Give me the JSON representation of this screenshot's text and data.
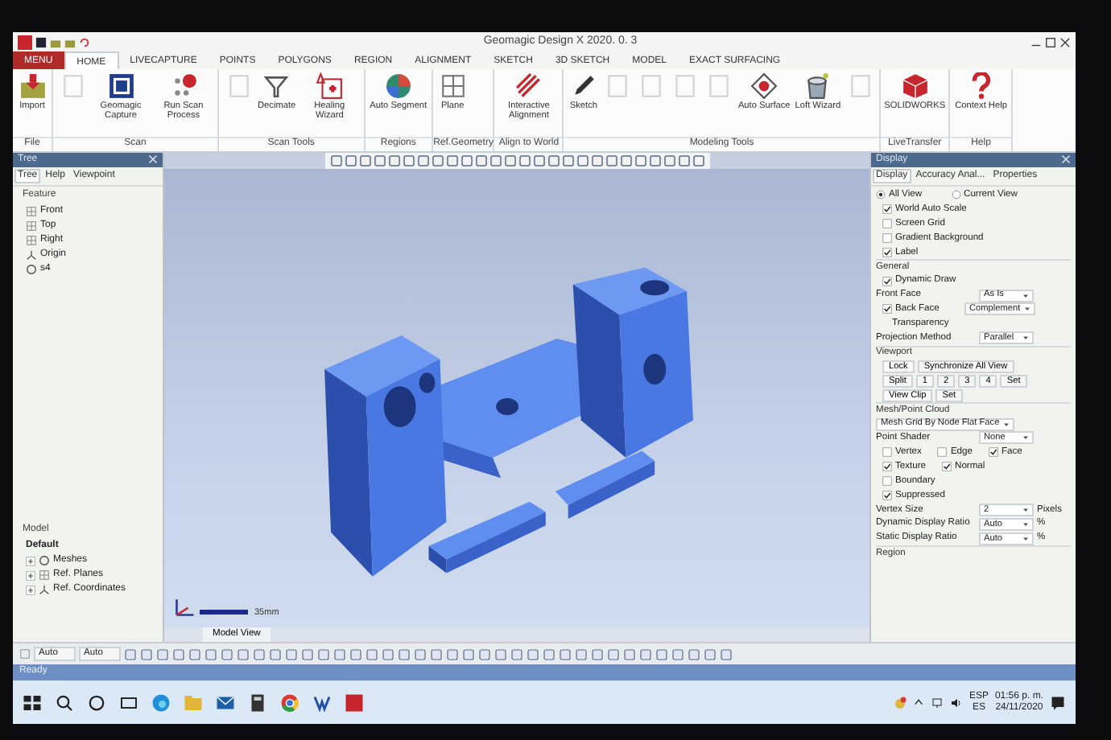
{
  "window": {
    "title": "Geomagic Design X 2020. 0. 3"
  },
  "ribbon_tabs": [
    {
      "label": "MENU",
      "kind": "menu",
      "selected": false
    },
    {
      "label": "HOME",
      "kind": "tab",
      "selected": true
    },
    {
      "label": "LIVECAPTURE",
      "kind": "tab",
      "selected": false
    },
    {
      "label": "POINTS",
      "kind": "tab",
      "selected": false
    },
    {
      "label": "POLYGONS",
      "kind": "tab",
      "selected": false
    },
    {
      "label": "REGION",
      "kind": "tab",
      "selected": false
    },
    {
      "label": "ALIGNMENT",
      "kind": "tab",
      "selected": false
    },
    {
      "label": "SKETCH",
      "kind": "tab",
      "selected": false
    },
    {
      "label": "3D SKETCH",
      "kind": "tab",
      "selected": false
    },
    {
      "label": "MODEL",
      "kind": "tab",
      "selected": false
    },
    {
      "label": "EXACT SURFACING",
      "kind": "tab",
      "selected": false
    }
  ],
  "ribbon_groups": [
    {
      "label": "File",
      "buttons": [
        {
          "label": "Import",
          "disabled": false
        }
      ]
    },
    {
      "label": "Scan",
      "buttons": [
        {
          "disabled": true
        },
        {
          "label": "Geomagic Capture",
          "disabled": false
        },
        {
          "label": "Run Scan Process",
          "disabled": false
        }
      ]
    },
    {
      "label": "Scan Tools",
      "buttons": [
        {
          "disabled": true
        },
        {
          "label": "Decimate",
          "disabled": false
        },
        {
          "label": "Healing Wizard",
          "disabled": false
        }
      ]
    },
    {
      "label": "Regions",
      "buttons": [
        {
          "label": "Auto Segment",
          "disabled": false
        }
      ]
    },
    {
      "label": "Ref.Geometry",
      "buttons": [
        {
          "label": "Plane",
          "disabled": false
        }
      ]
    },
    {
      "label": "Align to World",
      "buttons": [
        {
          "label": "Interactive Alignment",
          "disabled": false
        }
      ]
    },
    {
      "label": "Modeling Tools",
      "buttons": [
        {
          "label": "Sketch",
          "disabled": false
        },
        {
          "disabled": true
        },
        {
          "disabled": true
        },
        {
          "disabled": true
        },
        {
          "disabled": true
        },
        {
          "label": "Auto Surface",
          "disabled": false
        },
        {
          "label": "Loft Wizard",
          "disabled": false
        },
        {
          "disabled": true
        }
      ]
    },
    {
      "label": "LiveTransfer",
      "buttons": [
        {
          "label": "SOLIDWORKS",
          "disabled": false
        }
      ]
    },
    {
      "label": "Help",
      "buttons": [
        {
          "label": "Context Help",
          "disabled": false
        }
      ]
    }
  ],
  "tree_panel": {
    "title": "Tree",
    "tabs": [
      {
        "label": "Tree",
        "selected": true
      },
      {
        "label": "Help",
        "selected": false
      },
      {
        "label": "Viewpoint",
        "selected": false
      }
    ],
    "feature_heading": "Feature",
    "features": [
      {
        "label": "Front",
        "kind": "plane"
      },
      {
        "label": "Top",
        "kind": "plane"
      },
      {
        "label": "Right",
        "kind": "plane"
      },
      {
        "label": "Origin",
        "kind": "origin"
      },
      {
        "label": "s4",
        "kind": "mesh"
      }
    ],
    "model_heading": "Model",
    "model_root": "Default",
    "model_items": [
      {
        "label": "Meshes",
        "kind": "mesh",
        "expanded": false
      },
      {
        "label": "Ref. Planes",
        "kind": "plane",
        "expanded": false
      },
      {
        "label": "Ref. Coordinates",
        "kind": "origin",
        "expanded": false
      }
    ]
  },
  "viewport": {
    "scale_label": "35mm",
    "view_tab": "Model View"
  },
  "display_panel": {
    "title": "Display",
    "tabs": [
      {
        "label": "Display",
        "selected": true
      },
      {
        "label": "Accuracy Anal...",
        "selected": false
      },
      {
        "label": "Properties",
        "selected": false
      }
    ],
    "rows": [
      {
        "kind": "radios",
        "options": [
          {
            "label": "All View",
            "selected": true
          },
          {
            "label": "Current View",
            "selected": false
          }
        ]
      },
      {
        "kind": "check",
        "label": "World Auto Scale",
        "checked": true
      },
      {
        "kind": "check",
        "label": "Screen Grid",
        "checked": false
      },
      {
        "kind": "check",
        "label": "Gradient Background",
        "checked": false
      },
      {
        "kind": "check",
        "label": "Label",
        "checked": true
      },
      {
        "kind": "heading",
        "label": "General"
      },
      {
        "kind": "check",
        "label": "Dynamic Draw",
        "checked": true
      },
      {
        "kind": "select",
        "label": "Front Face",
        "value": "As Is"
      },
      {
        "kind": "check_select",
        "label": "Back Face",
        "checked": true,
        "value": "Complement"
      },
      {
        "kind": "text",
        "label": "Transparency"
      },
      {
        "kind": "select",
        "label": "Projection Method",
        "value": "Parallel"
      },
      {
        "kind": "heading",
        "label": "Viewport"
      },
      {
        "kind": "buttons",
        "items": [
          "Lock",
          "Synchronize All View"
        ]
      },
      {
        "kind": "buttons",
        "items": [
          "Split",
          "1",
          "2",
          "3",
          "4",
          "Set"
        ]
      },
      {
        "kind": "buttons",
        "items": [
          "View Clip",
          "Set"
        ]
      },
      {
        "kind": "heading",
        "label": "Mesh/Point Cloud"
      },
      {
        "kind": "select",
        "value": "Mesh Grid By Node Flat Face"
      },
      {
        "kind": "select",
        "label": "Point Shader",
        "value": "None"
      },
      {
        "kind": "checks",
        "items": [
          {
            "label": "Vertex",
            "checked": false
          },
          {
            "label": "Edge",
            "checked": false
          },
          {
            "label": "Face",
            "checked": true
          }
        ]
      },
      {
        "kind": "checks",
        "items": [
          {
            "label": "Texture",
            "checked": true
          },
          {
            "label": "Normal",
            "checked": true
          }
        ]
      },
      {
        "kind": "check",
        "label": "Boundary",
        "checked": false
      },
      {
        "kind": "check",
        "label": "Suppressed",
        "checked": true
      },
      {
        "kind": "select",
        "label": "Vertex Size",
        "value": "2",
        "unit": "Pixels"
      },
      {
        "kind": "select",
        "label": "Dynamic Display Ratio",
        "value": "Auto",
        "unit": "%"
      },
      {
        "kind": "select",
        "label": "Static Display Ratio",
        "value": "Auto",
        "unit": "%"
      },
      {
        "kind": "heading",
        "label": "Region"
      }
    ]
  },
  "bottom_toolbar": {
    "fields": [
      "Auto",
      "Auto"
    ]
  },
  "status_bar": {
    "text": "Ready"
  },
  "taskbar": {
    "tray": {
      "language": "ESP",
      "layout": "ES",
      "time": "01:56 p. m.",
      "date": "24/11/2020"
    }
  }
}
